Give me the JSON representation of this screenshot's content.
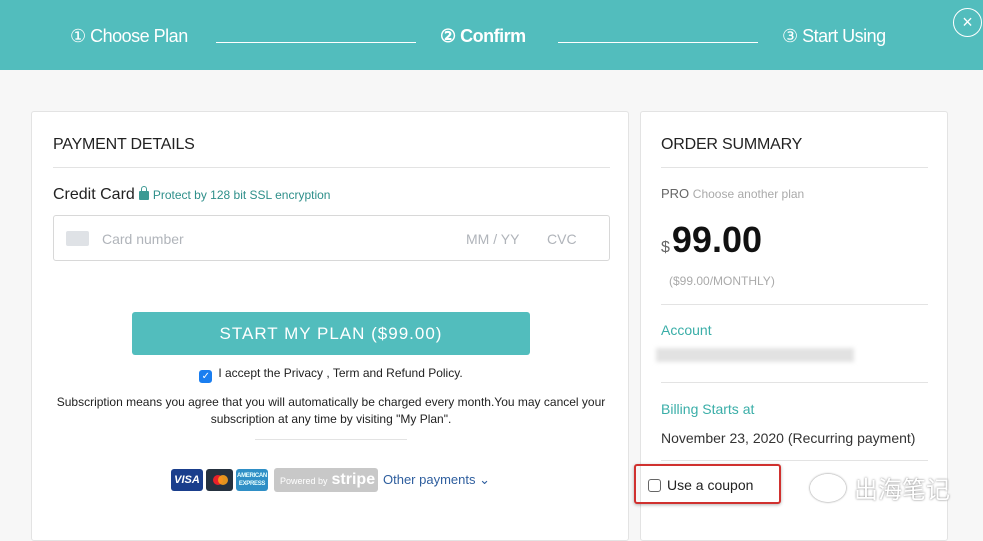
{
  "steps": [
    {
      "label": "① Choose Plan"
    },
    {
      "label": "② Confirm"
    },
    {
      "label": "③ Start Using"
    }
  ],
  "close_icon": "×",
  "payment": {
    "title": "PAYMENT DETAILS",
    "credit_card_label": "Credit Card",
    "ssl_note": "Protect by 128 bit SSL encryption",
    "card_placeholder": "Card number",
    "expiry_placeholder": "MM / YY",
    "cvc_placeholder": "CVC",
    "submit_label": "START MY PLAN ($99.00)",
    "accept_text": "I accept the Privacy , Term and Refund Policy.",
    "accept_checked": true,
    "subscription_note": "Subscription means you agree that you will automatically be charged every month.You may cancel your subscription at any time by visiting \"My Plan\".",
    "card_brands": [
      "VISA",
      "Mastercard",
      "American Express"
    ],
    "powered_by": "Powered by",
    "stripe": "stripe",
    "other_payments": "Other payments"
  },
  "summary": {
    "title": "ORDER SUMMARY",
    "plan": "PRO",
    "choose_another": "Choose another plan",
    "currency": "$",
    "amount": "99.00",
    "period": "($99.00/MONTHLY)",
    "account_label": "Account",
    "billing_label": "Billing Starts at",
    "billing_value": "November 23, 2020 (Recurring payment)",
    "coupon_label": "Use a coupon",
    "coupon_checked": false
  },
  "watermark": "出海笔记",
  "colors": {
    "accent": "#52bdbd",
    "highlight": "#d0312f",
    "link": "#2e5e9e"
  }
}
